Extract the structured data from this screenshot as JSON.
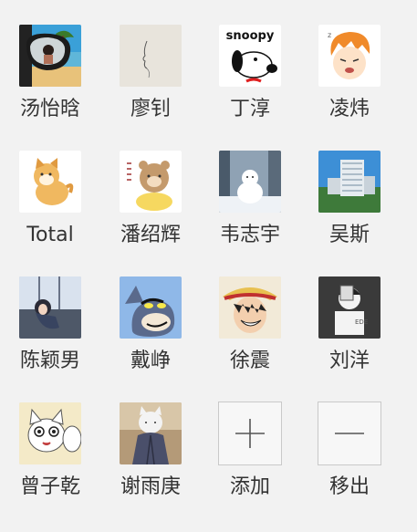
{
  "members": [
    {
      "name": "汤怡晗",
      "avatar_icon": "car-mirror-selfie-avatar"
    },
    {
      "name": "廖钊",
      "avatar_icon": "sketch-face-avatar"
    },
    {
      "name": "丁淳",
      "avatar_icon": "snoopy-avatar",
      "avatar_text": "snoopy"
    },
    {
      "name": "凌炜",
      "avatar_icon": "orange-hair-cartoon-avatar"
    },
    {
      "name": "Total",
      "avatar_icon": "shiba-dog-avatar"
    },
    {
      "name": "潘绍辉",
      "avatar_icon": "cartoon-bear-avatar"
    },
    {
      "name": "韦志宇",
      "avatar_icon": "white-dog-snow-avatar"
    },
    {
      "name": "吴斯",
      "avatar_icon": "building-photo-avatar"
    },
    {
      "name": "陈颖男",
      "avatar_icon": "anime-girl-window-avatar"
    },
    {
      "name": "戴峥",
      "avatar_icon": "tom-cat-avatar"
    },
    {
      "name": "徐震",
      "avatar_icon": "luffy-avatar"
    },
    {
      "name": "刘洋",
      "avatar_icon": "cartoon-boy-dark-avatar"
    },
    {
      "name": "曾子乾",
      "avatar_icon": "cartoon-cat-avatar"
    },
    {
      "name": "谢雨庚",
      "avatar_icon": "white-cat-robe-avatar"
    }
  ],
  "actions": [
    {
      "label": "添加",
      "icon": "plus-icon"
    },
    {
      "label": "移出",
      "icon": "minus-icon"
    }
  ]
}
